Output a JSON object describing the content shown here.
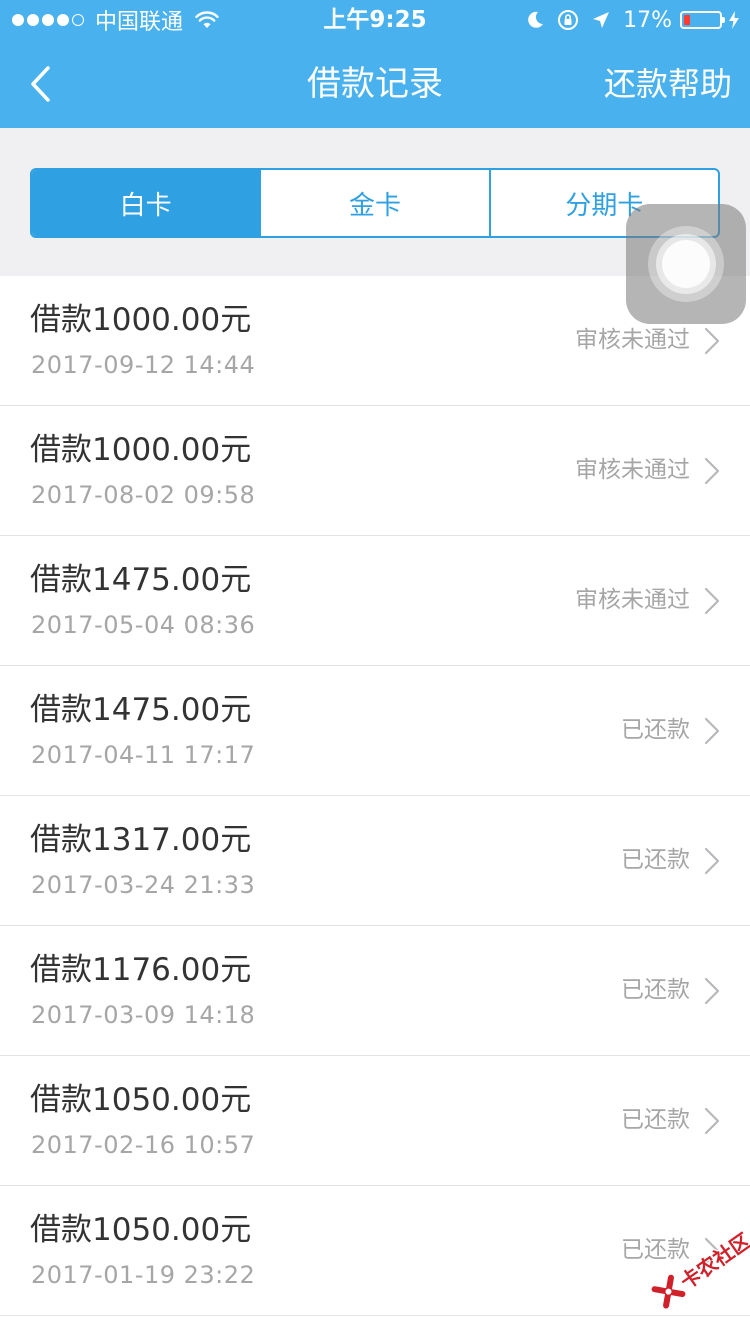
{
  "status_bar": {
    "carrier": "中国联通",
    "time": "上午9:25",
    "battery_percent": "17%",
    "battery_level": 0.17,
    "signal_bars": 4,
    "signal_total": 5
  },
  "nav": {
    "title": "借款记录",
    "help_label": "还款帮助",
    "back_icon": "chevron-left-icon",
    "bar_color": "#49b1ee"
  },
  "segments": {
    "active_index": 0,
    "accent_color": "#2fa1e3",
    "tabs": [
      {
        "label": "白卡"
      },
      {
        "label": "金卡"
      },
      {
        "label": "分期卡"
      }
    ]
  },
  "records": [
    {
      "amount": "借款1000.00元",
      "date": "2017-09-12 14:44",
      "status": "审核未通过"
    },
    {
      "amount": "借款1000.00元",
      "date": "2017-08-02 09:58",
      "status": "审核未通过"
    },
    {
      "amount": "借款1475.00元",
      "date": "2017-05-04 08:36",
      "status": "审核未通过"
    },
    {
      "amount": "借款1475.00元",
      "date": "2017-04-11 17:17",
      "status": "已还款"
    },
    {
      "amount": "借款1317.00元",
      "date": "2017-03-24 21:33",
      "status": "已还款"
    },
    {
      "amount": "借款1176.00元",
      "date": "2017-03-09 14:18",
      "status": "已还款"
    },
    {
      "amount": "借款1050.00元",
      "date": "2017-02-16 10:57",
      "status": "已还款"
    },
    {
      "amount": "借款1050.00元",
      "date": "2017-01-19 23:22",
      "status": "已还款"
    }
  ],
  "watermark": {
    "text": "卡农社区"
  }
}
